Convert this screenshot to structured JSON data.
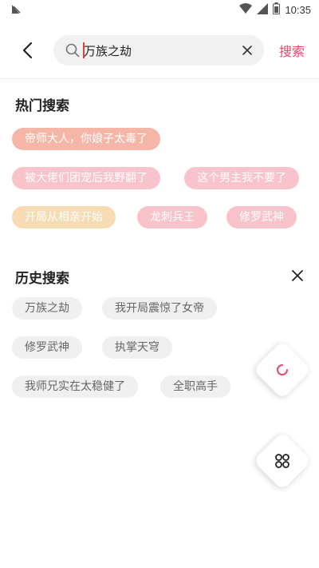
{
  "status_bar": {
    "time": "10:35"
  },
  "search": {
    "value": "万族之劫",
    "button_label": "搜索"
  },
  "hot": {
    "title": "热门搜索",
    "tags": [
      "帝师大人，你娘子太毒了",
      "被大佬们团宠后我野翻了",
      "这个男主我不要了",
      "开局从相亲开始",
      "龙刺兵王",
      "修罗武神"
    ]
  },
  "history": {
    "title": "历史搜索",
    "tags": [
      "万族之劫",
      "我开局震惊了女帝",
      "修罗武神",
      "执掌天穹",
      "我师兄实在太稳健了",
      "全职高手"
    ]
  },
  "colors": {
    "accent": "#e8476a",
    "hot_tag_salmon": "#f5b6a8",
    "hot_tag_pink": "#f8c3ca",
    "hot_tag_yellow": "#f7dcb3",
    "history_tag_bg": "#f0f0f0"
  },
  "icons": {
    "back": "chevron-left-icon",
    "search": "search-icon",
    "clear": "close-icon",
    "refresh": "refresh-icon",
    "grid": "grid-icon"
  }
}
